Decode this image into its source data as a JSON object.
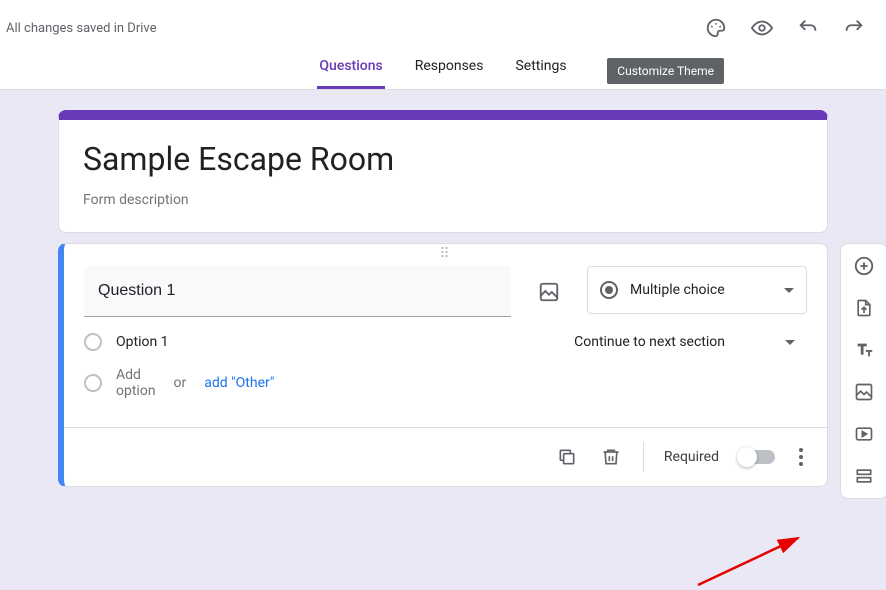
{
  "topbar": {
    "save_status": "All changes saved in Drive",
    "tooltip": "Customize Theme"
  },
  "tabs": {
    "questions": "Questions",
    "responses": "Responses",
    "settings": "Settings"
  },
  "form": {
    "title": "Sample Escape Room",
    "description": "Form description"
  },
  "question": {
    "title": "Question 1",
    "type_label": "Multiple choice",
    "option1": "Option 1",
    "add_option": "Add option",
    "or": "or",
    "add_other": "add \"Other\"",
    "section_nav": "Continue to next section",
    "required": "Required"
  }
}
